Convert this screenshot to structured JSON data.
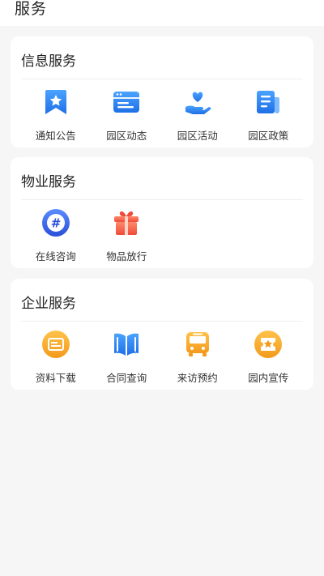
{
  "header": {
    "title": "服务"
  },
  "sections": [
    {
      "title": "信息服务",
      "items": [
        {
          "label": "通知公告",
          "icon": "bookmark-star-icon"
        },
        {
          "label": "园区动态",
          "icon": "browser-window-icon"
        },
        {
          "label": "园区活动",
          "icon": "heart-hand-icon"
        },
        {
          "label": "园区政策",
          "icon": "newspaper-icon"
        }
      ]
    },
    {
      "title": "物业服务",
      "items": [
        {
          "label": "在线咨询",
          "icon": "hashtag-icon"
        },
        {
          "label": "物品放行",
          "icon": "gift-icon"
        }
      ]
    },
    {
      "title": "企业服务",
      "items": [
        {
          "label": "资料下载",
          "icon": "document-card-icon"
        },
        {
          "label": "合同查询",
          "icon": "open-book-icon"
        },
        {
          "label": "来访预约",
          "icon": "bus-icon"
        },
        {
          "label": "园内宣传",
          "icon": "promo-ticket-icon"
        }
      ]
    }
  ],
  "colors": {
    "blue": "#2f80f0",
    "orange": "#f4a12a",
    "red": "#f0624a"
  }
}
